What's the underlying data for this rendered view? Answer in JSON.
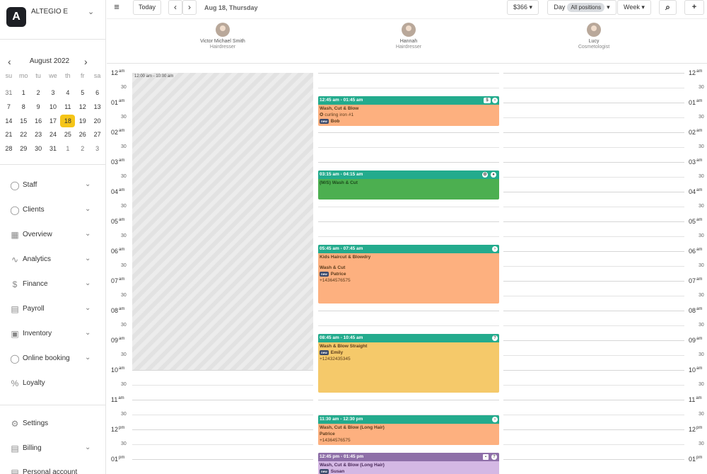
{
  "company": {
    "name": "ALTEGIO E",
    "logo_letter": "A"
  },
  "calendar": {
    "month_label": "August 2022",
    "weekdays": [
      "su",
      "mo",
      "tu",
      "we",
      "th",
      "fr",
      "sa"
    ],
    "weeks": [
      [
        "31",
        "1",
        "2",
        "3",
        "4",
        "5",
        "6"
      ],
      [
        "7",
        "8",
        "9",
        "10",
        "11",
        "12",
        "13"
      ],
      [
        "14",
        "15",
        "16",
        "17",
        "18",
        "19",
        "20"
      ],
      [
        "21",
        "22",
        "23",
        "24",
        "25",
        "26",
        "27"
      ],
      [
        "28",
        "29",
        "30",
        "31",
        "1",
        "2",
        "3"
      ]
    ],
    "selected": "18"
  },
  "nav": {
    "staff": "Staff",
    "clients": "Clients",
    "overview": "Overview",
    "analytics": "Analytics",
    "finance": "Finance",
    "payroll": "Payroll",
    "inventory": "Inventory",
    "online_booking": "Online booking",
    "loyalty": "Loyalty",
    "settings": "Settings",
    "billing": "Billing",
    "personal_account": "Personal account"
  },
  "toolbar": {
    "menu_glyph": "≡",
    "today": "Today",
    "date": "Aug 18, Thursday",
    "revenue": "$366",
    "day": "Day",
    "positions": "All positions",
    "week": "Week",
    "zoom_glyph": "⌕",
    "add_user_glyph": "+"
  },
  "staff": [
    {
      "name": "Victor Michael Smith",
      "role": "Hairdresser"
    },
    {
      "name": "Hannah",
      "role": "Hairdresser"
    },
    {
      "name": "Lucy",
      "role": "Cosmetologist"
    }
  ],
  "time_labels": {
    "h12am": "12",
    "h01": "01",
    "h02": "02",
    "h03": "03",
    "h04": "04",
    "h05": "05",
    "h06": "06",
    "h07": "07",
    "h08": "08",
    "h09": "09",
    "h10": "10",
    "h11": "11",
    "h12pm": "12",
    "h01pm": "01",
    "half": "30",
    "am": "am",
    "pm": "pm"
  },
  "blocked": {
    "label": "12:00 am - 10:00 am"
  },
  "appointments": [
    {
      "time": "12:45 am - 01:45 am",
      "service": "Wash, Cut & Blow",
      "extra": "✪ curling iron #1",
      "badge": "new",
      "client": "Bob",
      "phone": ""
    },
    {
      "time": "03:15 am - 04:15 am",
      "service": "(M/S) Wash & Cut",
      "extra": "",
      "badge": "",
      "client": "",
      "phone": ""
    },
    {
      "time": "05:45 am - 07:45 am",
      "service": "Kids Haircut & Blowdry",
      "extra": "Wash & Cut",
      "badge": "new",
      "client": "Patrice",
      "phone": "+14364576575"
    },
    {
      "time": "08:45 am - 10:45 am",
      "service": "Wash & Blow Straight",
      "extra": "",
      "badge": "new",
      "client": "Emily",
      "phone": "+12432435345"
    },
    {
      "time": "11:30 am - 12:30 pm",
      "service": "Wash, Cut & Blow (Long Hair)",
      "extra": "",
      "badge": "",
      "client": "Patrice",
      "phone": "+14364576575"
    },
    {
      "time": "12:45 pm - 01:45 pm",
      "service": "Wash, Cut & Blow (Long Hair)",
      "extra": "",
      "badge": "new",
      "client": "Susan",
      "phone": ""
    }
  ],
  "colors": {
    "accent_teal": "#23ab8d",
    "orange": "#fdb07f",
    "green_header": "#23ab8d",
    "green_body": "#4caf50",
    "yellow": "#f5c96a",
    "purple_header": "#8e6fa8",
    "purple_body": "#d4b8e4",
    "selected_day": "#f5c518"
  }
}
